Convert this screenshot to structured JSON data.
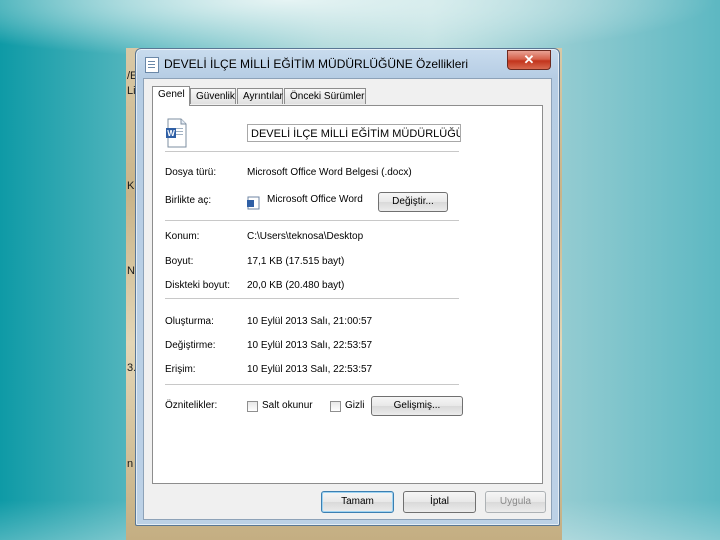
{
  "window": {
    "title": "DEVELİ İLÇE MİLLİ EĞİTİM MÜDÜRLÜĞÜNE Özellikleri",
    "close_label": "✕"
  },
  "tabs": [
    {
      "label": "Genel",
      "active": true
    },
    {
      "label": "Güvenlik",
      "active": false
    },
    {
      "label": "Ayrıntılar",
      "active": false
    },
    {
      "label": "Önceki Sürümler",
      "active": false
    }
  ],
  "general": {
    "file_name": "DEVELİ İLÇE MİLLİ EĞİTİM MÜDÜRLÜĞÜNE",
    "file_icon": "word-document-icon",
    "rows": {
      "file_type": {
        "label": "Dosya türü:",
        "value": "Microsoft Office Word Belgesi (.docx)"
      },
      "opens_with": {
        "label": "Birlikte aç:",
        "value": "Microsoft Office Word",
        "button": "Değiştir..."
      },
      "location": {
        "label": "Konum:",
        "value": "C:\\Users\\teknosa\\Desktop"
      },
      "size": {
        "label": "Boyut:",
        "value": "17,1 KB (17.515 bayt)"
      },
      "size_on_disk": {
        "label": "Diskteki boyut:",
        "value": "20,0 KB (20.480 bayt)"
      },
      "created": {
        "label": "Oluşturma:",
        "value": "10 Eylül 2013 Salı, 21:00:57"
      },
      "modified": {
        "label": "Değiştirme:",
        "value": "10 Eylül 2013 Salı, 22:53:57"
      },
      "accessed": {
        "label": "Erişim:",
        "value": "10 Eylül 2013 Salı, 22:53:57"
      },
      "attributes": {
        "label": "Öznitelikler:",
        "readonly": "Salt okunur",
        "hidden": "Gizli",
        "advanced": "Gelişmiş..."
      }
    }
  },
  "footer": {
    "ok": "Tamam",
    "cancel": "İptal",
    "apply": "Uygula"
  },
  "desktop_letters": [
    "/E",
    "Li",
    "▪",
    "Kı",
    "▪",
    "N",
    "▪",
    "3.",
    "n"
  ]
}
